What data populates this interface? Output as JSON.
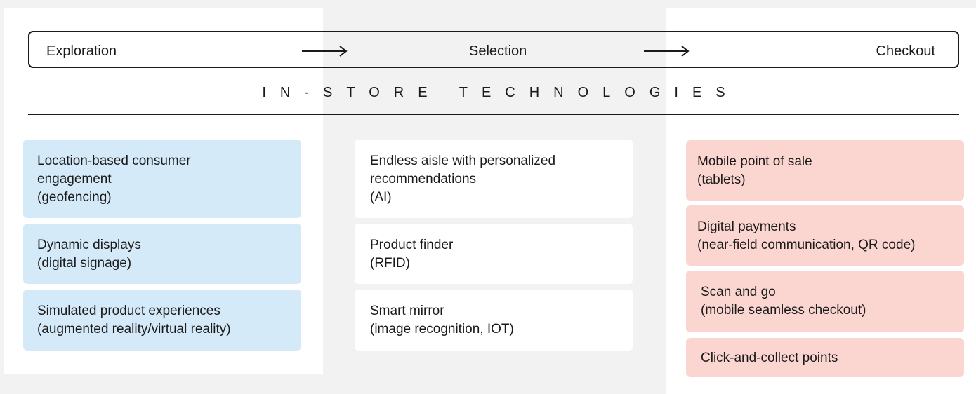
{
  "journey": {
    "stages": [
      "Exploration",
      "Selection",
      "Checkout"
    ]
  },
  "section_title": "IN-STORE TECHNOLOGIES",
  "colors": {
    "exploration_card": "#d5eaf9",
    "selection_card": "#ffffff",
    "checkout_card": "#fbd6d1",
    "line": "#1a1a1a"
  },
  "exploration": [
    {
      "lines": [
        "Location-based consumer",
        "engagement",
        "(geofencing)"
      ]
    },
    {
      "lines": [
        "Dynamic displays",
        "(digital signage)"
      ]
    },
    {
      "lines": [
        "Simulated product experiences",
        "(augmented reality/virtual reality)"
      ]
    }
  ],
  "selection": [
    {
      "lines": [
        "Endless aisle with personalized",
        "recommendations",
        "(AI)"
      ]
    },
    {
      "lines": [
        "Product finder",
        "(RFID)"
      ]
    },
    {
      "lines": [
        "Smart mirror",
        "(image recognition, IOT)"
      ]
    }
  ],
  "checkout": [
    {
      "lines": [
        "Mobile point of sale",
        "(tablets)"
      ]
    },
    {
      "lines": [
        "Digital payments",
        "(near-field communication, QR code)"
      ]
    },
    {
      "lines": [
        "Scan and go",
        "(mobile seamless checkout)"
      ]
    },
    {
      "lines": [
        "Click-and-collect points"
      ]
    }
  ]
}
